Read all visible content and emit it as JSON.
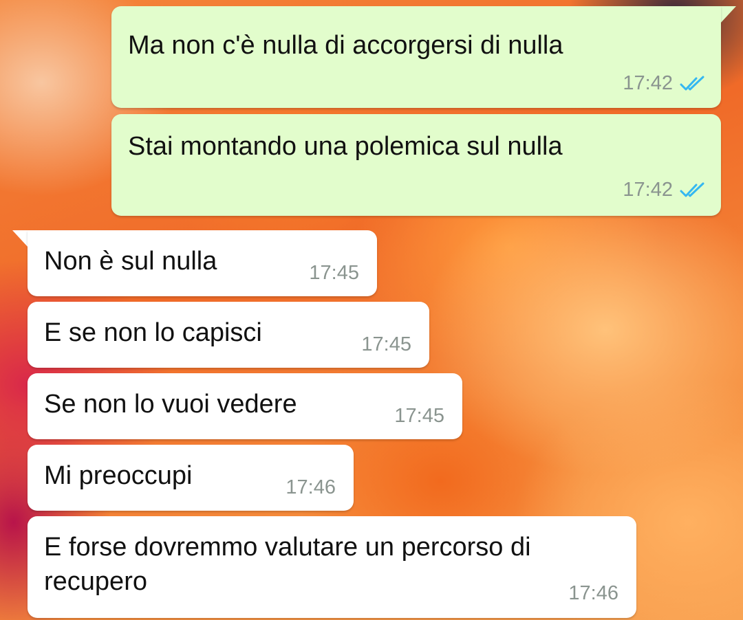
{
  "messages": [
    {
      "direction": "outgoing",
      "text": "Ma non c'è nulla di accorgersi di nulla",
      "time": "17:42",
      "status": "read",
      "status_icon": "double-check-icon",
      "status_color": "#34b7f1"
    },
    {
      "direction": "outgoing",
      "text": "Stai montando una polemica sul nulla",
      "time": "17:42",
      "status": "read",
      "status_icon": "double-check-icon",
      "status_color": "#34b7f1"
    },
    {
      "direction": "incoming",
      "text": "Non è sul nulla",
      "time": "17:45"
    },
    {
      "direction": "incoming",
      "text": "E se non lo capisci",
      "time": "17:45"
    },
    {
      "direction": "incoming",
      "text": "Se non lo vuoi vedere",
      "time": "17:45"
    },
    {
      "direction": "incoming",
      "text": "Mi preoccupi",
      "time": "17:46"
    },
    {
      "direction": "incoming",
      "text": "E forse dovremmo valutare un percorso di recupero",
      "time": "17:46"
    }
  ],
  "colors": {
    "outgoing_bubble": "#e2fdcc",
    "incoming_bubble": "#ffffff",
    "timestamp": "#8a948f",
    "read_ticks": "#34b7f1"
  }
}
